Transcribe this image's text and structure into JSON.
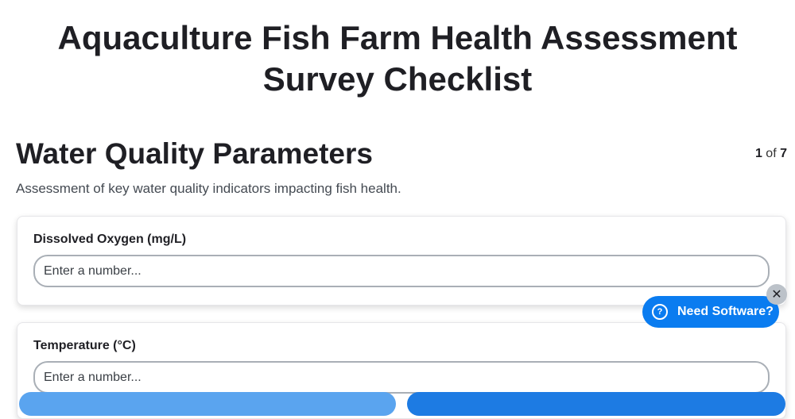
{
  "survey": {
    "title": "Aquaculture Fish Farm Health Assessment Survey Checklist"
  },
  "section": {
    "title": "Water Quality Parameters",
    "description": "Assessment of key water quality indicators impacting fish health.",
    "page_current": "1",
    "page_separator": " of ",
    "page_total": "7"
  },
  "fields": [
    {
      "label": "Dissolved Oxygen (mg/L)",
      "placeholder": "Enter a number...",
      "value": ""
    },
    {
      "label": "Temperature (°C)",
      "placeholder": "Enter a number...",
      "value": ""
    }
  ],
  "help_widget": {
    "label": "Need Software?",
    "icon": "question-circle-icon",
    "icon_glyph": "?",
    "close_glyph": "✕",
    "color": "#0a7cf0"
  },
  "colors": {
    "accent": "#1d7be3",
    "accent_light": "#5aa4ef"
  }
}
